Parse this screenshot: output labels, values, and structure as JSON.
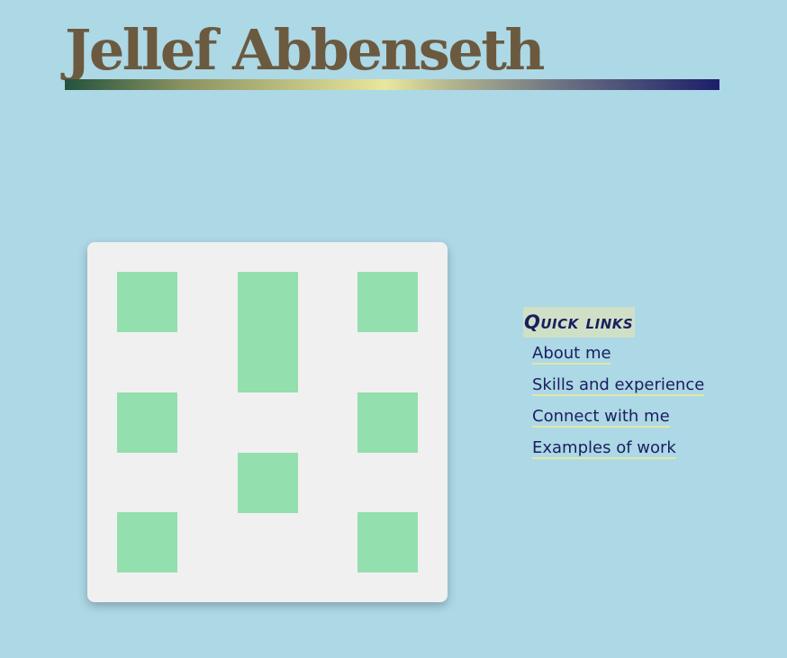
{
  "header": {
    "title": "Jellef Abbenseth"
  },
  "quick_links": {
    "heading": "Quick links",
    "items": [
      {
        "label": "About me"
      },
      {
        "label": "Skills and experience"
      },
      {
        "label": "Connect with me"
      },
      {
        "label": "Examples of work"
      }
    ]
  },
  "colors": {
    "page_background": "#add8e6",
    "title_text": "#6b5a3f",
    "card_background": "#f0f0f0",
    "tile": "#94dfae",
    "link_text": "#1b1e5e",
    "heading_background": "#cfe0c7",
    "link_underline": "#e2e6a8"
  }
}
